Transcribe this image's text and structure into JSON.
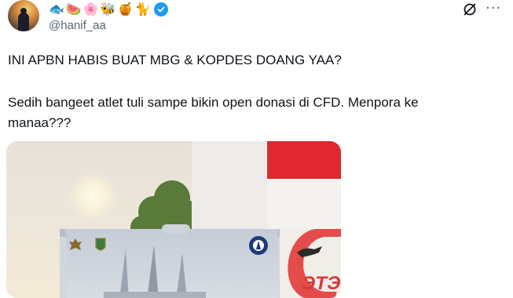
{
  "tweet": {
    "author": {
      "avatar_icon": "avatar",
      "name_emojis": [
        "🐟",
        "🍉",
        "🌸",
        "🐝",
        "🍯",
        "🐈"
      ],
      "verified_icon": "verified-badge-icon",
      "handle": "@hanif_aa"
    },
    "top_actions": {
      "grok_icon": "grok-icon",
      "more_label": "···"
    },
    "text_lines": [
      "INI APBN HABIS BUAT MBG & KOPDES DOANG YAA?",
      "Sedih bangeet atlet tuli sampe bikin open donasi di CFD. Menpora ke",
      "manaa???"
    ],
    "media": {
      "poster_text": "ЭТЭ"
    }
  },
  "colors": {
    "text": "#0f1419",
    "secondary": "#536471",
    "verified": "#1d9bf0",
    "flag_red": "#e0282f"
  }
}
